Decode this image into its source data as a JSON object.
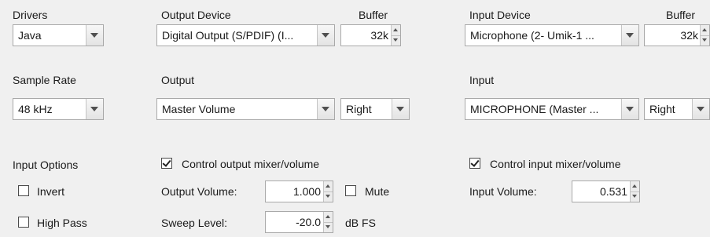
{
  "labels": {
    "drivers": "Drivers",
    "output_device": "Output Device",
    "output_buffer": "Buffer",
    "input_device": "Input Device",
    "input_buffer": "Buffer",
    "sample_rate": "Sample Rate",
    "output": "Output",
    "input": "Input",
    "input_options": "Input Options",
    "output_volume": "Output Volume:",
    "sweep_level": "Sweep Level:",
    "sweep_unit": "dB FS",
    "input_volume": "Input Volume:"
  },
  "drivers": {
    "value": "Java"
  },
  "output_device": {
    "value": "Digital Output (S/PDIF) (I...",
    "buffer": "32k"
  },
  "input_device": {
    "value": "Microphone (2- Umik-1  ...",
    "buffer": "32k"
  },
  "sample_rate": {
    "value": "48 kHz"
  },
  "output": {
    "mixer": "Master Volume",
    "channel": "Right"
  },
  "input": {
    "mixer": "MICROPHONE (Master ...",
    "channel": "Right"
  },
  "checkboxes": {
    "control_output": {
      "label": "Control output mixer/volume",
      "checked": true
    },
    "control_input": {
      "label": "Control input mixer/volume",
      "checked": true
    },
    "invert": {
      "label": "Invert",
      "checked": false
    },
    "high_pass": {
      "label": "High Pass",
      "checked": false
    },
    "mute": {
      "label": "Mute",
      "checked": false
    }
  },
  "output_volume": {
    "value": "1.000"
  },
  "sweep_level": {
    "value": "-20.0"
  },
  "input_volume": {
    "value": "0.531"
  },
  "colors": {
    "background": "#f0f0f0",
    "border": "#a9a9a9"
  },
  "icons": [
    "dropdown-arrow-icon",
    "spinner-up-icon",
    "spinner-down-icon",
    "checkmark-icon"
  ]
}
